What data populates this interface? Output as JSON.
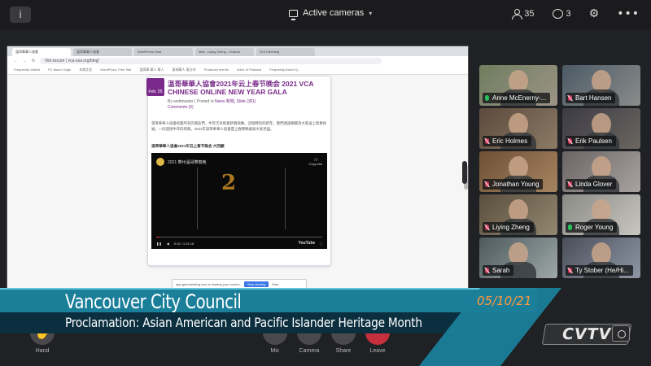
{
  "header": {
    "view_mode": "Active cameras",
    "participants_count": "35",
    "chat_count": "3"
  },
  "share": {
    "tabs": [
      "溫哥華華人協會",
      "溫哥華華人協會",
      "WordPress Host",
      "Mail - Liying Zheng - Outlook",
      "GCH Meeting"
    ],
    "url": "Not secure | vca-usa.org/blog/",
    "bookmarks": [
      "Frequently Visited",
      "PC Marco Sage",
      "本地文化",
      "WordPress: Free Site",
      "溫哥華 華人 華人",
      "東海華人 東方市",
      "Produced events",
      "Voice of Portland",
      "Frequently Asked Q..."
    ],
    "article": {
      "date_badge": "Feb. 05",
      "title": "溫哥華華人協會2021年云上春节晚会 2021 VCA CHINESE ONLINE NEW YEAR GALA",
      "meta_by": "By webmaster | Posted in",
      "meta_cat": "News 新聞, Slide (滾1)",
      "meta_comments": "Comments (0)",
      "body": "溫哥華華人協會祝賀所有的朋友們，牛年吉祥如意新春快樂。這個特別的新年，我們透過網路為大家送上新春祝福，一同迎接牛年的到來。2021年溫哥華華人協會雲上春節晚會與大家見面。",
      "subheading": "溫哥華華人協會2021年云上春节晚会 大回顧",
      "video": {
        "title": "2021 華州溫哥華春晚",
        "big_number": "2",
        "copy_label": "Copy link",
        "time": "0:16 / 1:01:18",
        "brand": "YouTube"
      }
    },
    "notice": {
      "text": "app.gotomeeting.com is sharing your screen.",
      "stop": "Stop sharing",
      "hide": "Hide"
    }
  },
  "participants": [
    {
      "name": "Anne McEnerny-...",
      "mic": "on"
    },
    {
      "name": "Bart Hansen",
      "mic": "off"
    },
    {
      "name": "Eric Holmes",
      "mic": "off"
    },
    {
      "name": "Erik Paulsen",
      "mic": "off"
    },
    {
      "name": "Jonathan Young",
      "mic": "off"
    },
    {
      "name": "Linda Glover",
      "mic": "off"
    },
    {
      "name": "Liying Zheng",
      "mic": "off"
    },
    {
      "name": "Roger Young",
      "mic": "on"
    },
    {
      "name": "Sarah",
      "mic": "off"
    },
    {
      "name": "Ty Stober (He/Hi...",
      "mic": "off"
    }
  ],
  "toolbar": {
    "hand": "Hand",
    "mic": "Mic",
    "camera": "Camera",
    "share": "Share",
    "leave": "Leave"
  },
  "lower_third": {
    "title": "Vancouver City Council",
    "subtitle": "Proclamation:  Asian American and Pacific Islander Heritage Month",
    "date": "05/10/21"
  },
  "logo": "CVTV",
  "colors": {
    "accent_bar": "#1b7f9a",
    "date_orange": "#ff9a3c",
    "mic_on": "#23c25b",
    "mic_off": "#d6365a",
    "article_purple": "#7a2a8a"
  }
}
